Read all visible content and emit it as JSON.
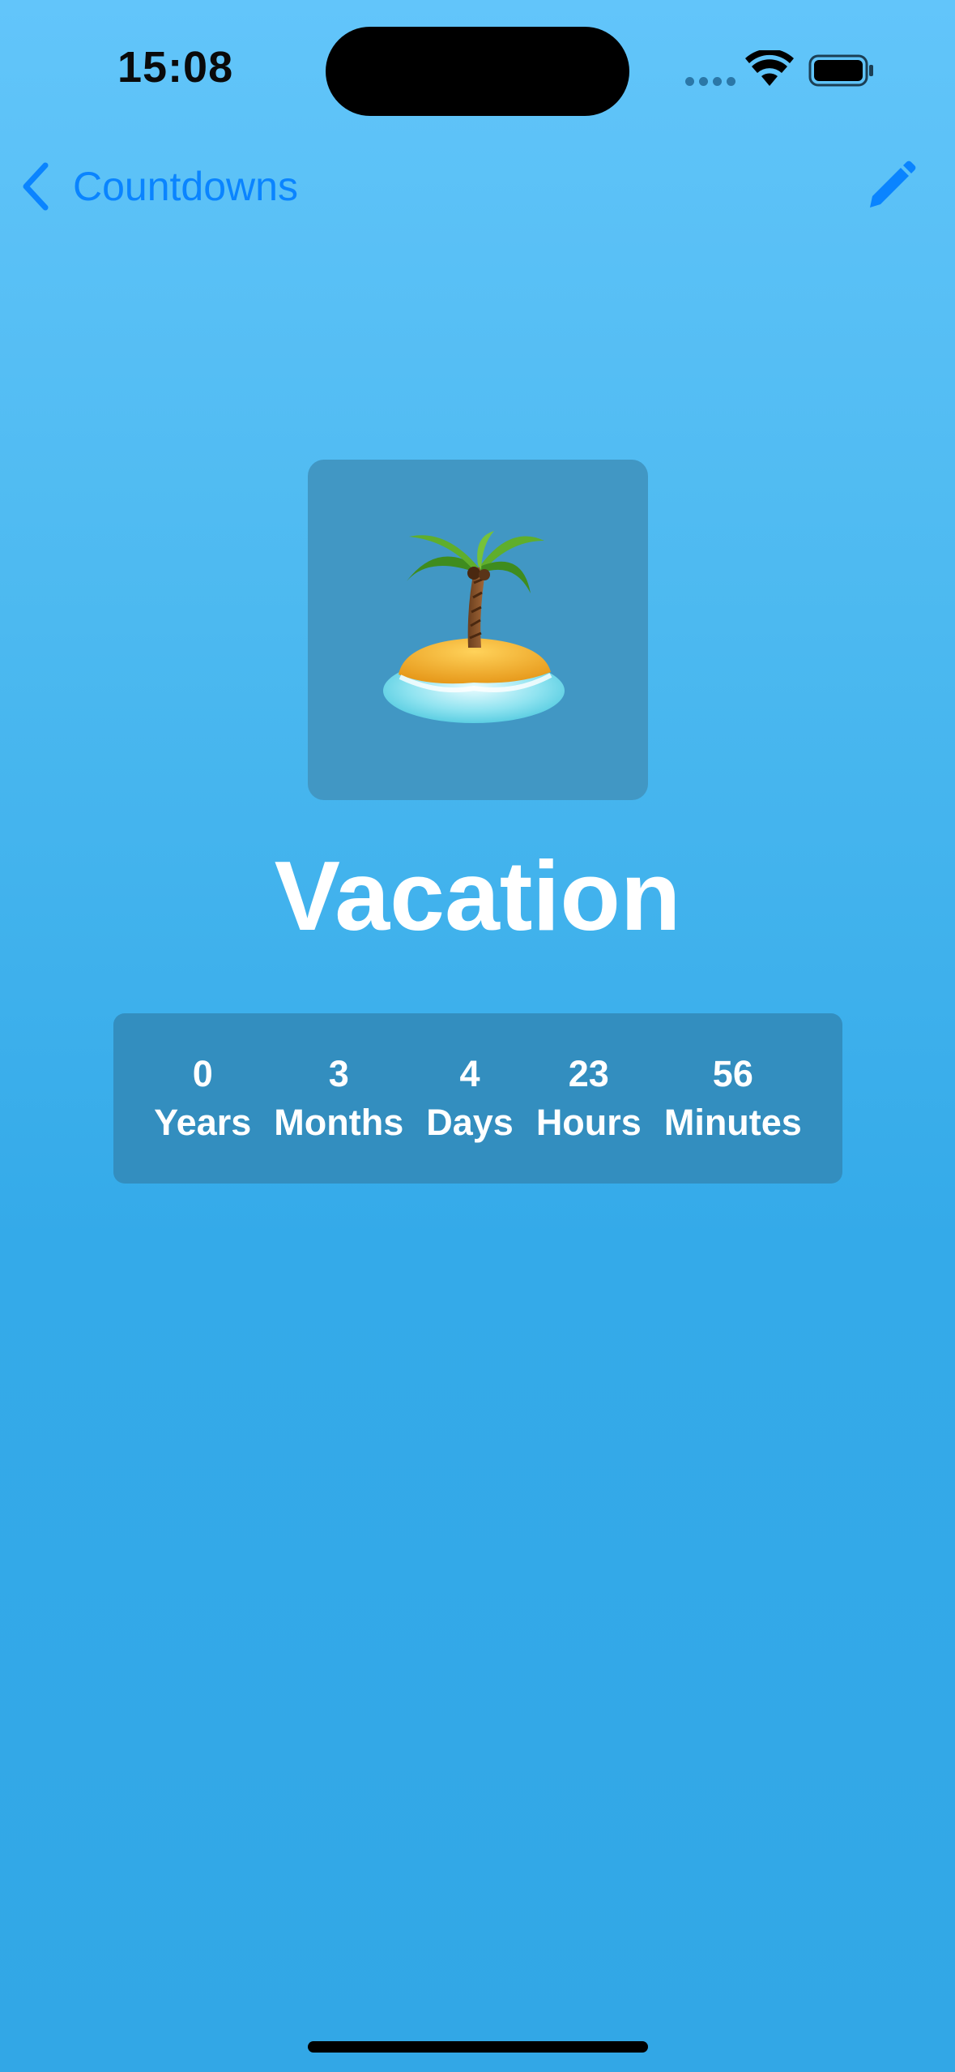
{
  "status_bar": {
    "time": "15:08"
  },
  "nav": {
    "back_label": "Countdowns",
    "back_icon": "chevron-left-icon",
    "edit_icon": "pencil-icon"
  },
  "event": {
    "icon": "desert-island-emoji",
    "title": "Vacation"
  },
  "countdown": {
    "items": [
      {
        "value": "0",
        "unit": "Years"
      },
      {
        "value": "3",
        "unit": "Months"
      },
      {
        "value": "4",
        "unit": "Days"
      },
      {
        "value": "23",
        "unit": "Hours"
      },
      {
        "value": "56",
        "unit": "Minutes"
      }
    ]
  },
  "colors": {
    "accent": "#0a84ff",
    "background_top": "#62c5fa",
    "background_bottom": "#32a7e6",
    "panel": "#338ebf"
  }
}
